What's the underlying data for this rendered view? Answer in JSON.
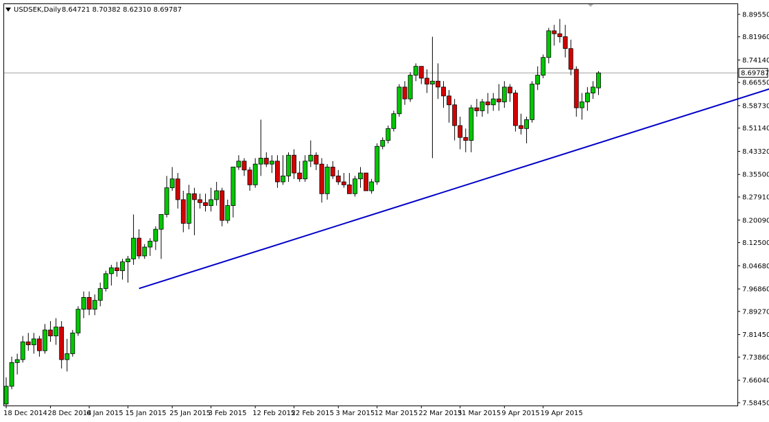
{
  "header": {
    "menu_icon": "triangle-down-icon",
    "symbol": "USDSEK,Daily",
    "ohlc": "8.64721 8.70382 8.62310 8.69787"
  },
  "current_price_label": "8.69787",
  "colors": {
    "bull": "#00c800",
    "bear": "#d40000",
    "wick": "#000000",
    "trendline": "#0000c8",
    "price_line": "#a0a0a0",
    "frame": "#000000",
    "background": "#ffffff"
  },
  "chart_data": {
    "type": "candlestick",
    "title": "",
    "xlabel": "",
    "ylabel": "",
    "ylim": [
      7.575,
      8.93
    ],
    "y_ticks": [
      "8.89550",
      "8.81960",
      "8.74140",
      "8.66550",
      "8.58730",
      "8.51140",
      "8.43320",
      "8.35500",
      "8.27910",
      "8.20090",
      "8.12500",
      "8.04680",
      "7.96860",
      "7.89270",
      "7.81450",
      "7.73860",
      "7.66040",
      "7.58450"
    ],
    "x_tick_labels": [
      {
        "label": "18 Dec 2014",
        "bar": 0
      },
      {
        "label": "28 Dec 2014",
        "bar": 8
      },
      {
        "label": "6 Jan 2015",
        "bar": 15
      },
      {
        "label": "15 Jan 2015",
        "bar": 22
      },
      {
        "label": "25 Jan 2015",
        "bar": 30
      },
      {
        "label": "3 Feb 2015",
        "bar": 37
      },
      {
        "label": "12 Feb 2015",
        "bar": 45
      },
      {
        "label": "22 Feb 2015",
        "bar": 52
      },
      {
        "label": "3 Mar 2015",
        "bar": 60
      },
      {
        "label": "12 Mar 2015",
        "bar": 67
      },
      {
        "label": "22 Mar 2015",
        "bar": 75
      },
      {
        "label": "31 Mar 2015",
        "bar": 82
      },
      {
        "label": "9 Apr 2015",
        "bar": 90
      },
      {
        "label": "19 Apr 2015",
        "bar": 97
      }
    ],
    "candles": [
      [
        7.58,
        7.67,
        7.57,
        7.64
      ],
      [
        7.64,
        7.74,
        7.63,
        7.72
      ],
      [
        7.72,
        7.75,
        7.68,
        7.73
      ],
      [
        7.73,
        7.81,
        7.72,
        7.79
      ],
      [
        7.79,
        7.82,
        7.76,
        7.78
      ],
      [
        7.78,
        7.82,
        7.75,
        7.8
      ],
      [
        7.8,
        7.81,
        7.74,
        7.76
      ],
      [
        7.76,
        7.85,
        7.75,
        7.83
      ],
      [
        7.83,
        7.86,
        7.79,
        7.81
      ],
      [
        7.81,
        7.87,
        7.78,
        7.84
      ],
      [
        7.84,
        7.86,
        7.7,
        7.73
      ],
      [
        7.73,
        7.8,
        7.69,
        7.75
      ],
      [
        7.75,
        7.83,
        7.74,
        7.82
      ],
      [
        7.82,
        7.91,
        7.81,
        7.9
      ],
      [
        7.9,
        7.96,
        7.87,
        7.94
      ],
      [
        7.94,
        7.96,
        7.88,
        7.9
      ],
      [
        7.9,
        7.95,
        7.88,
        7.93
      ],
      [
        7.93,
        7.99,
        7.91,
        7.97
      ],
      [
        7.97,
        8.03,
        7.96,
        8.02
      ],
      [
        8.02,
        8.05,
        7.98,
        8.04
      ],
      [
        8.04,
        8.06,
        8.01,
        8.03
      ],
      [
        8.03,
        8.07,
        8.0,
        8.06
      ],
      [
        8.06,
        8.08,
        7.99,
        8.07
      ],
      [
        8.07,
        8.22,
        8.05,
        8.14
      ],
      [
        8.14,
        8.17,
        8.07,
        8.08
      ],
      [
        8.08,
        8.12,
        8.07,
        8.11
      ],
      [
        8.11,
        8.14,
        8.08,
        8.13
      ],
      [
        8.13,
        8.18,
        8.1,
        8.17
      ],
      [
        8.17,
        8.21,
        8.07,
        8.22
      ],
      [
        8.22,
        8.35,
        8.21,
        8.31
      ],
      [
        8.31,
        8.38,
        8.3,
        8.34
      ],
      [
        8.34,
        8.36,
        8.24,
        8.27
      ],
      [
        8.27,
        8.3,
        8.16,
        8.19
      ],
      [
        8.19,
        8.32,
        8.17,
        8.29
      ],
      [
        8.29,
        8.31,
        8.15,
        8.27
      ],
      [
        8.27,
        8.29,
        8.24,
        8.26
      ],
      [
        8.26,
        8.29,
        8.23,
        8.25
      ],
      [
        8.25,
        8.31,
        8.23,
        8.27
      ],
      [
        8.27,
        8.33,
        8.25,
        8.3
      ],
      [
        8.3,
        8.31,
        8.18,
        8.2
      ],
      [
        8.2,
        8.27,
        8.19,
        8.25
      ],
      [
        8.25,
        8.37,
        8.21,
        8.38
      ],
      [
        8.38,
        8.42,
        8.37,
        8.4
      ],
      [
        8.4,
        8.41,
        8.35,
        8.37
      ],
      [
        8.37,
        8.38,
        8.3,
        8.32
      ],
      [
        8.32,
        8.41,
        8.31,
        8.39
      ],
      [
        8.39,
        8.54,
        8.35,
        8.41
      ],
      [
        8.41,
        8.43,
        8.38,
        8.39
      ],
      [
        8.39,
        8.42,
        8.36,
        8.4
      ],
      [
        8.4,
        8.42,
        8.31,
        8.33
      ],
      [
        8.33,
        8.42,
        8.32,
        8.35
      ],
      [
        8.35,
        8.43,
        8.33,
        8.42
      ],
      [
        8.42,
        8.44,
        8.34,
        8.36
      ],
      [
        8.36,
        8.4,
        8.33,
        8.34
      ],
      [
        8.34,
        8.42,
        8.33,
        8.4
      ],
      [
        8.4,
        8.47,
        8.38,
        8.42
      ],
      [
        8.42,
        8.43,
        8.37,
        8.39
      ],
      [
        8.39,
        8.41,
        8.26,
        8.29
      ],
      [
        8.29,
        8.39,
        8.27,
        8.38
      ],
      [
        8.38,
        8.4,
        8.34,
        8.35
      ],
      [
        8.35,
        8.37,
        8.32,
        8.33
      ],
      [
        8.33,
        8.36,
        8.31,
        8.32
      ],
      [
        8.32,
        8.36,
        8.3,
        8.29
      ],
      [
        8.29,
        8.35,
        8.28,
        8.34
      ],
      [
        8.34,
        8.38,
        8.31,
        8.36
      ],
      [
        8.36,
        8.34,
        8.3,
        8.3
      ],
      [
        8.3,
        8.34,
        8.29,
        8.33
      ]
    ],
    "candles_note_shown": false,
    "candles_b": [
      [
        8.33,
        8.46,
        8.32,
        8.45
      ],
      [
        8.45,
        8.48,
        8.44,
        8.47
      ],
      [
        8.47,
        8.52,
        8.46,
        8.51
      ],
      [
        8.51,
        8.57,
        8.5,
        8.56
      ],
      [
        8.56,
        8.66,
        8.55,
        8.65
      ],
      [
        8.65,
        8.67,
        8.59,
        8.61
      ],
      [
        8.61,
        8.7,
        8.6,
        8.69
      ],
      [
        8.69,
        8.73,
        8.67,
        8.72
      ],
      [
        8.72,
        8.7,
        8.66,
        8.68
      ],
      [
        8.68,
        8.71,
        8.63,
        8.66
      ],
      [
        8.66,
        8.82,
        8.41,
        8.67
      ],
      [
        8.67,
        8.73,
        8.61,
        8.65
      ],
      [
        8.65,
        8.67,
        8.58,
        8.62
      ],
      [
        8.62,
        8.64,
        8.53,
        8.59
      ],
      [
        8.59,
        8.61,
        8.47,
        8.52
      ],
      [
        8.52,
        8.55,
        8.44,
        8.48
      ],
      [
        8.48,
        8.51,
        8.43,
        8.47
      ],
      [
        8.47,
        8.59,
        8.43,
        8.58
      ],
      [
        8.58,
        8.61,
        8.55,
        8.57
      ],
      [
        8.57,
        8.61,
        8.55,
        8.6
      ],
      [
        8.6,
        8.63,
        8.56,
        8.59
      ],
      [
        8.59,
        8.63,
        8.57,
        8.61
      ],
      [
        8.61,
        8.66,
        8.57,
        8.6
      ],
      [
        8.6,
        8.67,
        8.58,
        8.65
      ],
      [
        8.65,
        8.66,
        8.6,
        8.63
      ],
      [
        8.63,
        8.64,
        8.5,
        8.52
      ],
      [
        8.52,
        8.56,
        8.49,
        8.51
      ],
      [
        8.51,
        8.55,
        8.46,
        8.54
      ],
      [
        8.54,
        8.67,
        8.53,
        8.66
      ],
      [
        8.66,
        8.72,
        8.64,
        8.69
      ],
      [
        8.69,
        8.76,
        8.68,
        8.75
      ],
      [
        8.75,
        8.85,
        8.73,
        8.84
      ],
      [
        8.84,
        8.86,
        8.79,
        8.83
      ],
      [
        8.83,
        8.88,
        8.8,
        8.82
      ],
      [
        8.82,
        8.86,
        8.75,
        8.78
      ],
      [
        8.78,
        8.81,
        8.69,
        8.71
      ],
      [
        8.71,
        8.72,
        8.55,
        8.58
      ],
      [
        8.58,
        8.63,
        8.54,
        8.6
      ],
      [
        8.6,
        8.65,
        8.57,
        8.63
      ],
      [
        8.63,
        8.67,
        8.61,
        8.65
      ],
      [
        8.64721,
        8.70382,
        8.6231,
        8.69787
      ]
    ],
    "trendline": [
      {
        "bar": 24,
        "price": 7.97
      },
      {
        "bar": 144,
        "price": 8.68
      }
    ],
    "current_price": 8.69787
  }
}
